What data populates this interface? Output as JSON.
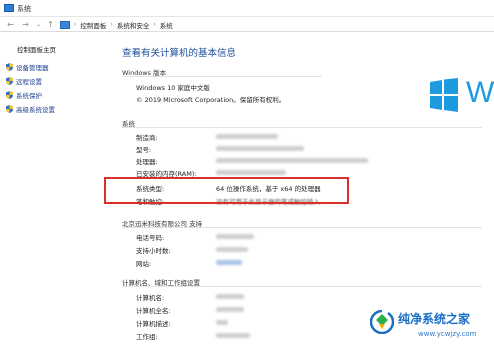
{
  "window": {
    "title": "系统"
  },
  "address": {
    "crumbs": [
      "控制面板",
      "系统和安全",
      "系统"
    ]
  },
  "sidebar": {
    "home": "控制面板主页",
    "items": [
      {
        "label": "设备管理器",
        "icon": "shield-icon"
      },
      {
        "label": "远程设置",
        "icon": "shield-icon"
      },
      {
        "label": "系统保护",
        "icon": "shield-icon"
      },
      {
        "label": "高级系统设置",
        "icon": "shield-icon"
      }
    ]
  },
  "main": {
    "title": "查看有关计算机的基本信息",
    "edition_section": "Windows 版本",
    "edition_name": "Windows 10 家庭中文版",
    "copyright": "© 2019 Microsoft Corporation。保留所有权利。",
    "logo_letter": "W",
    "system_section": "系统",
    "system_rows": [
      {
        "label": "制造商:",
        "value": ""
      },
      {
        "label": "型号:",
        "value": ""
      },
      {
        "label": "处理器:",
        "value": ""
      },
      {
        "label": "已安装的内存(RAM):",
        "value": ""
      },
      {
        "label": "系统类型:",
        "value": "64 位操作系统，基于 x64 的处理器"
      },
      {
        "label": "笔和触控:",
        "value": "没有可用于此显示器的笔或触控输入"
      }
    ],
    "support_section": "北京迅米科技有限公司 支持",
    "support_rows": [
      {
        "label": "电话号码:"
      },
      {
        "label": "支持小时数:"
      },
      {
        "label": "网站:"
      }
    ],
    "computer_section": "计算机名、域和工作组设置",
    "computer_rows": [
      {
        "label": "计算机名:"
      },
      {
        "label": "计算机全名:"
      },
      {
        "label": "计算机描述:"
      },
      {
        "label": "工作组:"
      }
    ]
  },
  "watermark": {
    "text": "纯净系统之家",
    "url": "www.ycwjzy.com"
  },
  "colors": {
    "accent": "#1d4f9a",
    "highlight": "#d9302a",
    "windows_blue": "#1e9be0"
  }
}
